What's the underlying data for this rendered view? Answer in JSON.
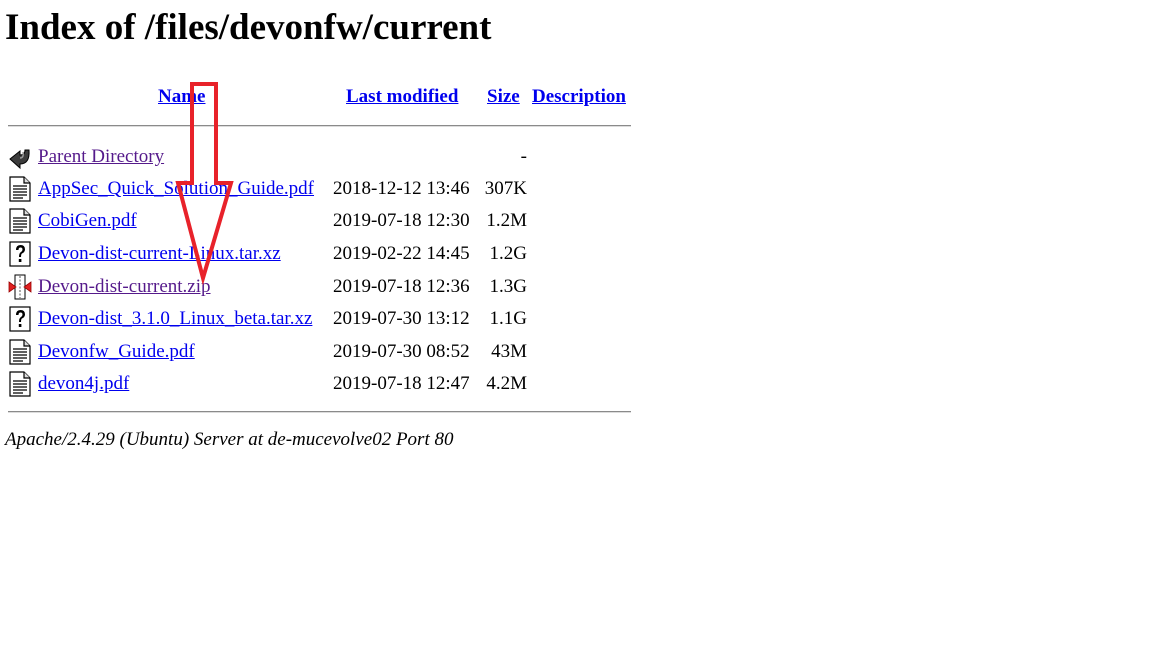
{
  "page": {
    "title": "Index of /files/devonfw/current"
  },
  "table": {
    "headers": {
      "name": "Name",
      "last_modified": "Last modified",
      "size": "Size",
      "description": "Description"
    },
    "rows": [
      {
        "icon": "back-icon",
        "name": "Parent Directory",
        "modified": "",
        "size": "-"
      },
      {
        "icon": "document-icon",
        "name": "AppSec_Quick_Solution_Guide.pdf",
        "modified": "2018-12-12 13:46",
        "size": "307K"
      },
      {
        "icon": "document-icon",
        "name": "CobiGen.pdf",
        "modified": "2019-07-18 12:30",
        "size": "1.2M"
      },
      {
        "icon": "unknown-file-icon",
        "name": "Devon-dist-current-Linux.tar.xz",
        "modified": "2019-02-22 14:45",
        "size": "1.2G"
      },
      {
        "icon": "compressed-file-icon",
        "name": "Devon-dist-current.zip",
        "modified": "2019-07-18 12:36",
        "size": "1.3G"
      },
      {
        "icon": "unknown-file-icon",
        "name": "Devon-dist_3.1.0_Linux_beta.tar.xz",
        "modified": "2019-07-30 13:12",
        "size": "1.1G"
      },
      {
        "icon": "document-icon",
        "name": "Devonfw_Guide.pdf",
        "modified": "2019-07-30 08:52",
        "size": "43M"
      },
      {
        "icon": "document-icon",
        "name": "devon4j.pdf",
        "modified": "2019-07-18 12:47",
        "size": "4.2M"
      }
    ]
  },
  "footer": {
    "text": "Apache/2.4.29 (Ubuntu) Server at de-mucevolve02 Port 80"
  },
  "colors": {
    "link": "#0000ee",
    "visited_link": "#551a8b",
    "annotation_arrow": "#e8222a"
  }
}
